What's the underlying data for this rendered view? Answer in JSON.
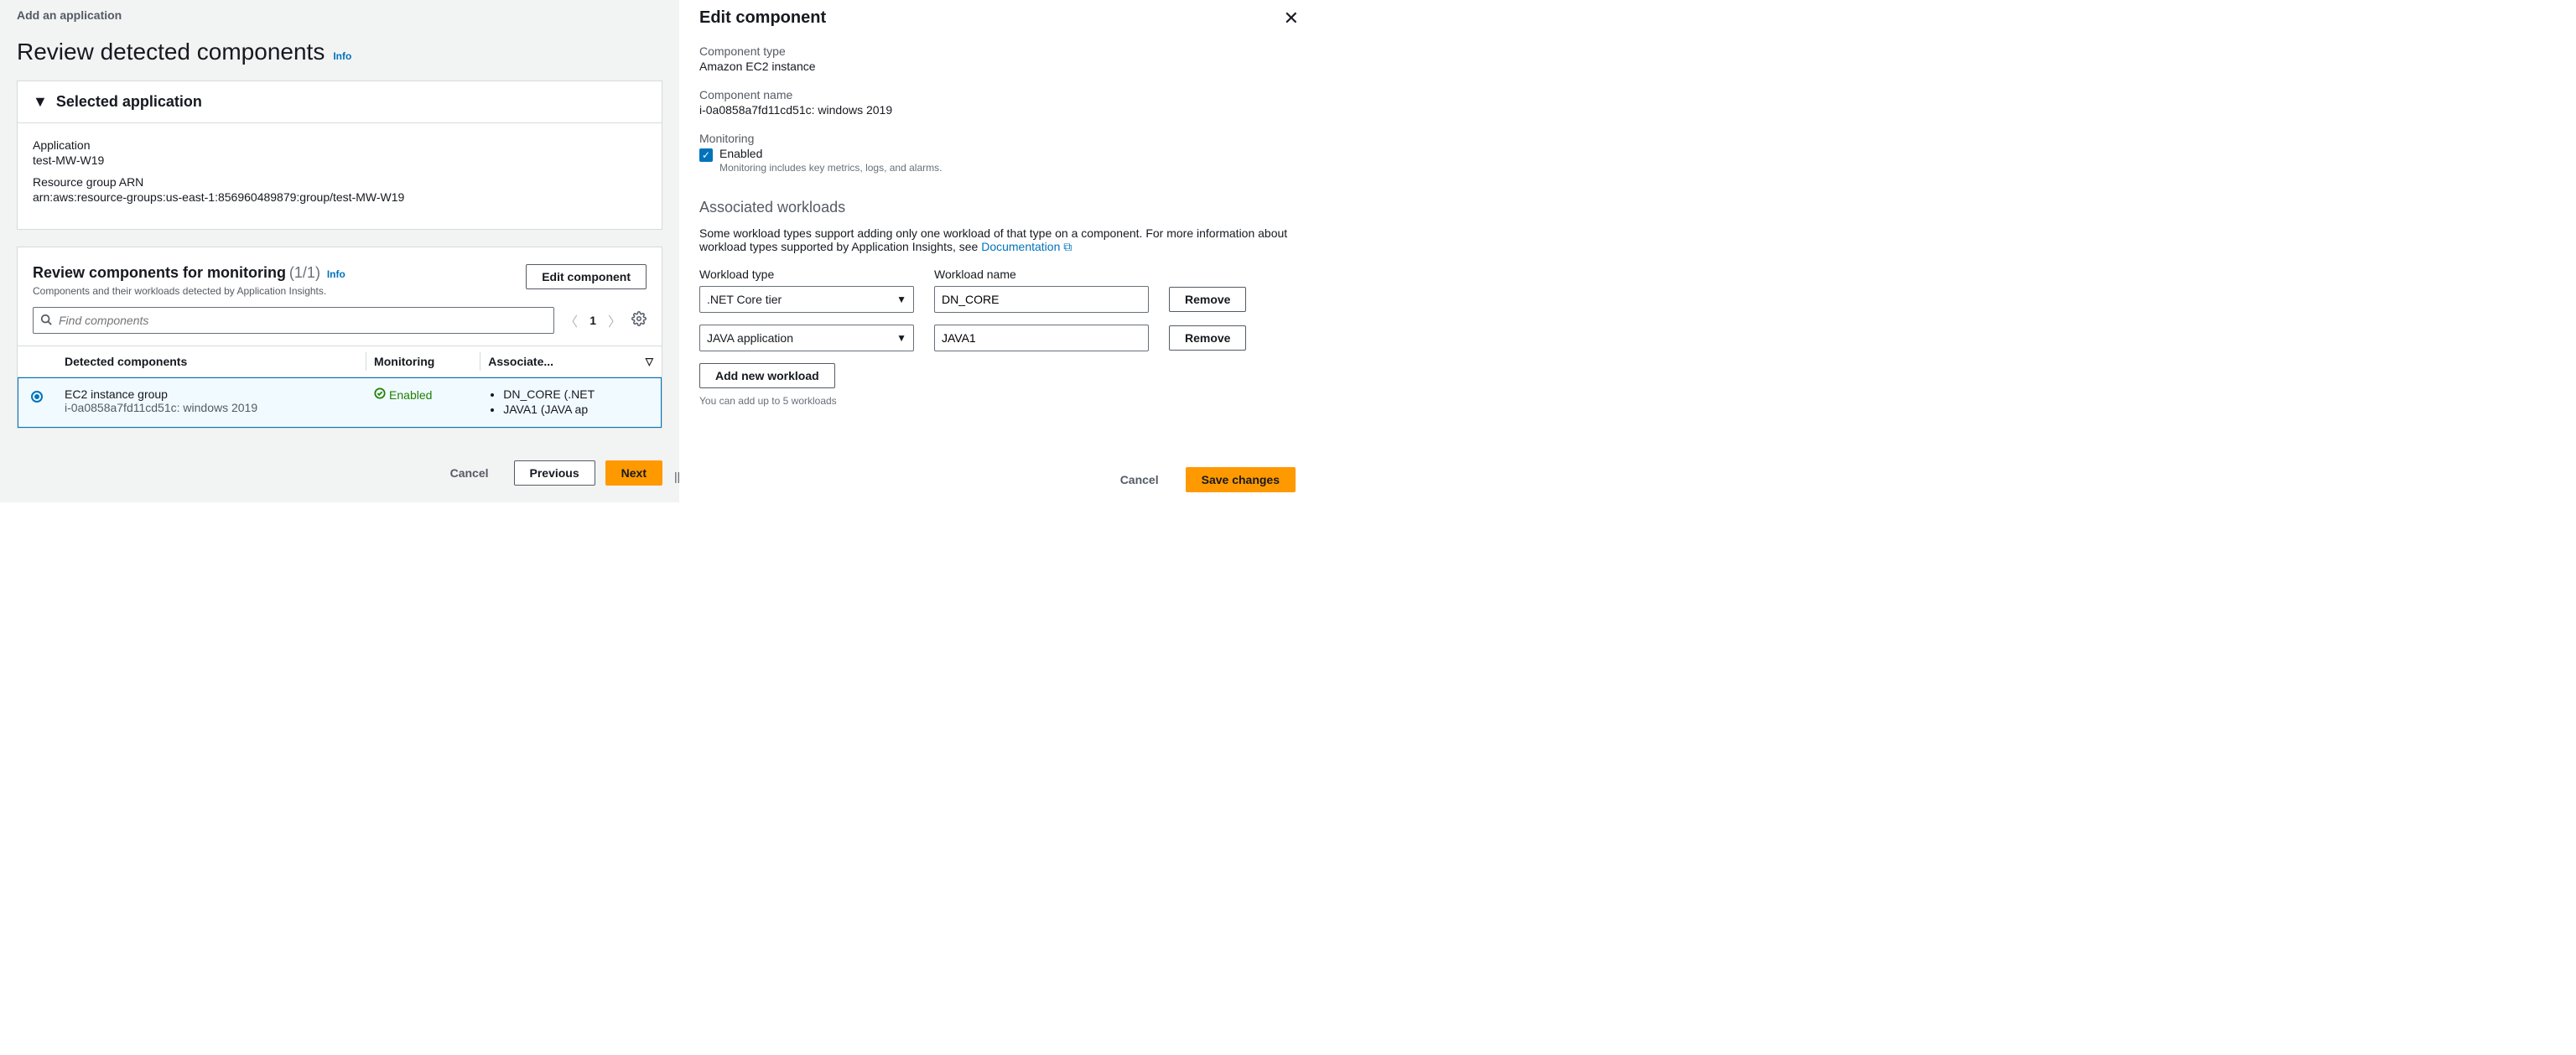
{
  "breadcrumb": "Add an application",
  "page_title": "Review detected components",
  "info_label": "Info",
  "selected_app_section": {
    "heading": "Selected application",
    "application_label": "Application",
    "application_value": "test-MW-W19",
    "arn_label": "Resource group ARN",
    "arn_value": "arn:aws:resource-groups:us-east-1:856960489879:group/test-MW-W19"
  },
  "review_section": {
    "title": "Review components for monitoring",
    "count_text": "(1/1)",
    "desc": "Components and their workloads detected by Application Insights.",
    "edit_btn": "Edit component",
    "search_placeholder": "Find components",
    "page_number": "1",
    "columns": {
      "detected": "Detected components",
      "monitoring": "Monitoring",
      "associated": "Associate..."
    },
    "row": {
      "name": "EC2 instance group",
      "detail": "i-0a0858a7fd11cd51c: windows 2019",
      "monitoring_status": "Enabled",
      "workloads": [
        "DN_CORE (.NET",
        "JAVA1 (JAVA ap"
      ]
    }
  },
  "bottom_actions": {
    "cancel": "Cancel",
    "previous": "Previous",
    "next": "Next"
  },
  "side": {
    "title": "Edit component",
    "component_type_label": "Component type",
    "component_type_value": "Amazon EC2 instance",
    "component_name_label": "Component name",
    "component_name_value": "i-0a0858a7fd11cd51c: windows 2019",
    "monitoring_label": "Monitoring",
    "monitoring_enabled_label": "Enabled",
    "monitoring_hint": "Monitoring includes key metrics, logs, and alarms.",
    "assoc_heading": "Associated workloads",
    "assoc_desc_pre": "Some workload types support adding only one workload of that type on a component. For more information about workload types supported by Application Insights, see ",
    "assoc_doc_link": "Documentation",
    "workload_type_label": "Workload type",
    "workload_name_label": "Workload name",
    "workloads": [
      {
        "type": ".NET Core tier",
        "name": "DN_CORE"
      },
      {
        "type": "JAVA application",
        "name": "JAVA1"
      }
    ],
    "remove_btn": "Remove",
    "add_btn": "Add new workload",
    "add_hint": "You can add up to 5 workloads",
    "footer_cancel": "Cancel",
    "footer_save": "Save changes"
  }
}
